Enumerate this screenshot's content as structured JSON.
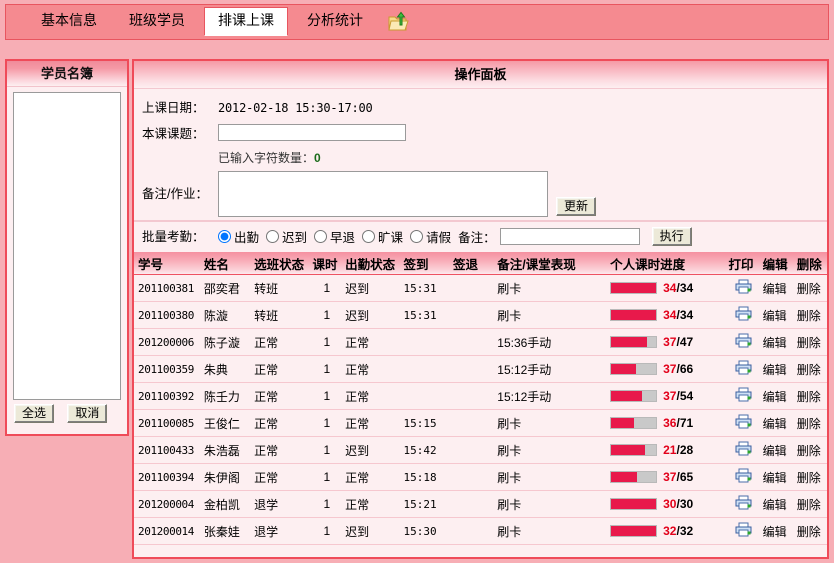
{
  "tabs": [
    {
      "label": "基本信息",
      "active": false
    },
    {
      "label": "班级学员",
      "active": false
    },
    {
      "label": "排课上课",
      "active": true
    },
    {
      "label": "分析统计",
      "active": false
    }
  ],
  "tab_icon": "folder-export-icon",
  "sidebar": {
    "title": "学员名簿",
    "list_items": [],
    "select_all_label": "全选",
    "cancel_label": "取消"
  },
  "panel": {
    "title": "操作面板",
    "date_label": "上课日期：",
    "date_value": "2012-02-18 15:30-17:00",
    "topic_label": "本课课题：",
    "topic_value": "",
    "charcount_label": "已输入字符数量：",
    "charcount_value": "0",
    "remark_label": "备注/作业：",
    "remark_value": "",
    "update_label": "更新",
    "batch_label": "批量考勤：",
    "batch_options": [
      {
        "label": "出勤",
        "checked": true
      },
      {
        "label": "迟到",
        "checked": false
      },
      {
        "label": "早退",
        "checked": false
      },
      {
        "label": "旷课",
        "checked": false
      },
      {
        "label": "请假",
        "checked": false
      }
    ],
    "batch_remark_label": "备注：",
    "batch_remark_value": "",
    "exec_label": "执行"
  },
  "table": {
    "columns": [
      "学号",
      "姓名",
      "选班状态",
      "课时",
      "出勤状态",
      "签到",
      "签退",
      "备注/课堂表现",
      "个人课时进度",
      "打印",
      "编辑",
      "删除"
    ],
    "edit_label": "编辑",
    "delete_label": "删除",
    "print_icon": "printer-icon",
    "rows": [
      {
        "id": "201100381",
        "name": "邵奕君",
        "class_state": "转班",
        "hours": "1",
        "attendance": "迟到",
        "sign_in": "15:31",
        "sign_out": "",
        "remark": "刷卡",
        "progress_current": 34,
        "progress_total": 34
      },
      {
        "id": "201100380",
        "name": "陈漩",
        "class_state": "转班",
        "hours": "1",
        "attendance": "迟到",
        "sign_in": "15:31",
        "sign_out": "",
        "remark": "刷卡",
        "progress_current": 34,
        "progress_total": 34
      },
      {
        "id": "201200006",
        "name": "陈子漩",
        "class_state": "正常",
        "hours": "1",
        "attendance": "正常",
        "sign_in": "",
        "sign_out": "",
        "remark": "15:36手动",
        "progress_current": 37,
        "progress_total": 47
      },
      {
        "id": "201100359",
        "name": "朱典",
        "class_state": "正常",
        "hours": "1",
        "attendance": "正常",
        "sign_in": "",
        "sign_out": "",
        "remark": "15:12手动",
        "progress_current": 37,
        "progress_total": 66
      },
      {
        "id": "201100392",
        "name": "陈壬力",
        "class_state": "正常",
        "hours": "1",
        "attendance": "正常",
        "sign_in": "",
        "sign_out": "",
        "remark": "15:12手动",
        "progress_current": 37,
        "progress_total": 54
      },
      {
        "id": "201100085",
        "name": "王俊仁",
        "class_state": "正常",
        "hours": "1",
        "attendance": "正常",
        "sign_in": "15:15",
        "sign_out": "",
        "remark": "刷卡",
        "progress_current": 36,
        "progress_total": 71
      },
      {
        "id": "201100433",
        "name": "朱浩磊",
        "class_state": "正常",
        "hours": "1",
        "attendance": "迟到",
        "sign_in": "15:42",
        "sign_out": "",
        "remark": "刷卡",
        "progress_current": 21,
        "progress_total": 28
      },
      {
        "id": "201100394",
        "name": "朱伊阁",
        "class_state": "正常",
        "hours": "1",
        "attendance": "正常",
        "sign_in": "15:18",
        "sign_out": "",
        "remark": "刷卡",
        "progress_current": 37,
        "progress_total": 65
      },
      {
        "id": "201200004",
        "name": "金柏凯",
        "class_state": "退学",
        "hours": "1",
        "attendance": "正常",
        "sign_in": "15:21",
        "sign_out": "",
        "remark": "刷卡",
        "progress_current": 30,
        "progress_total": 30
      },
      {
        "id": "201200014",
        "name": "张秦娃",
        "class_state": "退学",
        "hours": "1",
        "attendance": "迟到",
        "sign_in": "15:30",
        "sign_out": "",
        "remark": "刷卡",
        "progress_current": 32,
        "progress_total": 32
      }
    ]
  },
  "colors": {
    "accent": "#ef4b59",
    "tabbar_bg": "#f58a90",
    "page_bg": "#f7aeb5",
    "panel_bg": "#fdeff1",
    "progress_fill": "#e8194b",
    "progress_track": "#c9c9c9",
    "progress_current_text": "#e2001a"
  }
}
